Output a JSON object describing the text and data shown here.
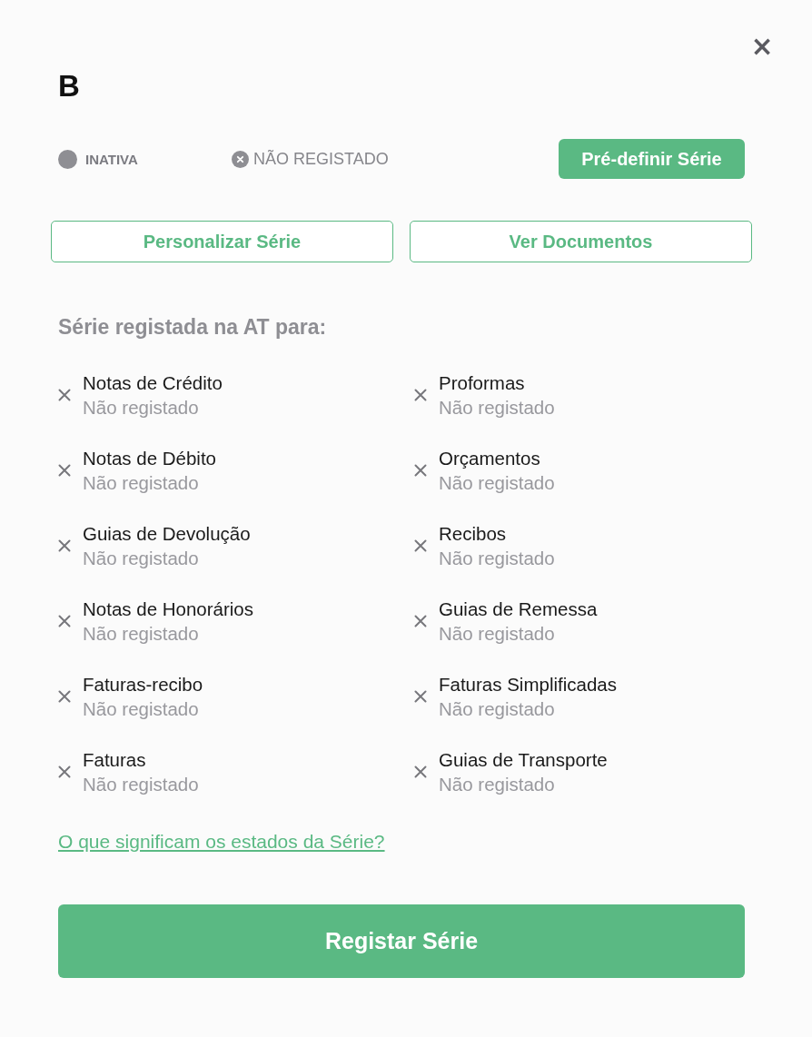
{
  "dialog": {
    "title": "B",
    "close_label": "×"
  },
  "statuses": [
    {
      "kind": "activity",
      "label": "INATIVA"
    },
    {
      "kind": "registration",
      "label": "NÃO REGISTADO"
    }
  ],
  "preset_button": "Pré-definir Série",
  "actions": [
    "Personalizar Série",
    "Ver Documentos"
  ],
  "section": {
    "heading": "Série registada na AT para:",
    "items": [
      {
        "name": "Notas de Crédito",
        "status": "Não registado",
        "registered": false
      },
      {
        "name": "Proformas",
        "status": "Não registado",
        "registered": false
      },
      {
        "name": "Notas de Débito",
        "status": "Não registado",
        "registered": false
      },
      {
        "name": "Orçamentos",
        "status": "Não registado",
        "registered": false
      },
      {
        "name": "Guias de Devolução",
        "status": "Não registado",
        "registered": false
      },
      {
        "name": "Recibos",
        "status": "Não registado",
        "registered": false
      },
      {
        "name": "Notas de Honorários",
        "status": "Não registado",
        "registered": false
      },
      {
        "name": "Guias de Remessa",
        "status": "Não registado",
        "registered": false
      },
      {
        "name": "Faturas-recibo",
        "status": "Não registado",
        "registered": false
      },
      {
        "name": "Faturas Simplificadas",
        "status": "Não registado",
        "registered": false
      },
      {
        "name": "Faturas",
        "status": "Não registado",
        "registered": false
      },
      {
        "name": "Guias de Transporte",
        "status": "Não registado",
        "registered": false
      }
    ]
  },
  "help_link": "O que significam os estados da Série?",
  "submit_button": "Registar Série"
}
